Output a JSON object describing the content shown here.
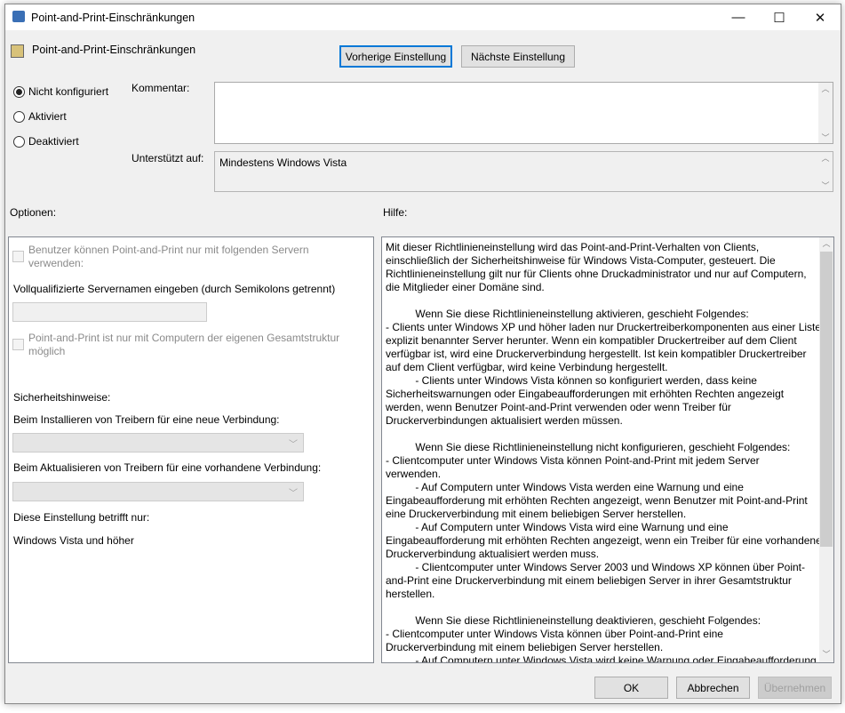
{
  "window": {
    "title": "Point-and-Print-Einschränkungen",
    "minimize": "—",
    "maximize": "☐",
    "close": "✕"
  },
  "header": {
    "policy_name": "Point-and-Print-Einschränkungen",
    "prev_button": "Vorherige Einstellung",
    "next_button": "Nächste Einstellung"
  },
  "state": {
    "options": [
      {
        "label": "Nicht konfiguriert",
        "selected": true
      },
      {
        "label": "Aktiviert",
        "selected": false
      },
      {
        "label": "Deaktiviert",
        "selected": false
      }
    ]
  },
  "comment": {
    "label": "Kommentar:",
    "value": ""
  },
  "supported": {
    "label": "Unterstützt auf:",
    "value": "Mindestens Windows Vista"
  },
  "options_label": "Optionen:",
  "help_label": "Hilfe:",
  "options": {
    "cb_servers": "Benutzer können Point-and-Print nur mit folgenden Servern\nverwenden:",
    "servernames_label": "Vollqualifizierte Servernamen eingeben (durch Semikolons getrennt)",
    "servernames_value": "",
    "cb_forest": "Point-and-Print ist nur mit Computern der eigenen Gesamtstruktur\nmöglich",
    "security_label": "Sicherheitshinweise:",
    "install_label": "Beim Installieren von Treibern für eine neue Verbindung:",
    "update_label": "Beim Aktualisieren von Treibern für eine vorhandene Verbindung:",
    "applies_label": "Diese Einstellung betrifft nur:",
    "applies_value": "Windows Vista und höher"
  },
  "help": {
    "lines": [
      "Mit dieser Richtlinieneinstellung wird das Point-and-Print-Verhalten von Clients,",
      "einschließlich der Sicherheitshinweise für Windows Vista-Computer, gesteuert. Die",
      "Richtlinieneinstellung gilt nur für Clients ohne Druckadministrator und nur auf Computern,",
      "die Mitglieder einer Domäne sind.",
      "",
      "          Wenn Sie diese Richtlinieneinstellung aktivieren, geschieht Folgendes:",
      "- Clients unter Windows XP und höher laden nur Druckertreiberkomponenten aus einer Liste",
      "explizit benannter Server herunter. Wenn ein kompatibler Druckertreiber auf dem Client",
      "verfügbar ist, wird eine Druckerverbindung hergestellt. Ist kein kompatibler Druckertreiber",
      "auf dem Client verfügbar, wird keine Verbindung hergestellt.",
      "          - Clients unter Windows Vista können so konfiguriert werden, dass keine",
      "Sicherheitswarnungen oder Eingabeaufforderungen mit erhöhten Rechten angezeigt",
      "werden, wenn Benutzer Point-and-Print verwenden oder wenn Treiber für",
      "Druckerverbindungen aktualisiert werden müssen.",
      "",
      "          Wenn Sie diese Richtlinieneinstellung nicht konfigurieren, geschieht Folgendes:",
      "- Clientcomputer unter Windows Vista können Point-and-Print mit jedem Server",
      "verwenden.",
      "          - Auf Computern unter Windows Vista werden eine Warnung und eine",
      "Eingabeaufforderung mit erhöhten Rechten angezeigt, wenn Benutzer mit Point-and-Print",
      "eine Druckerverbindung mit einem beliebigen Server herstellen.",
      "          - Auf Computern unter Windows Vista wird eine Warnung und eine",
      "Eingabeaufforderung mit erhöhten Rechten angezeigt, wenn ein Treiber für eine vorhandene",
      "Druckerverbindung aktualisiert werden muss.",
      "          - Clientcomputer unter Windows Server 2003 und Windows XP können über Point-",
      "and-Print eine Druckerverbindung mit einem beliebigen Server in ihrer Gesamtstruktur",
      "herstellen.",
      "",
      "          Wenn Sie diese Richtlinieneinstellung deaktivieren, geschieht Folgendes:",
      "- Clientcomputer unter Windows Vista können über Point-and-Print eine",
      "Druckerverbindung mit einem beliebigen Server herstellen.",
      "          - Auf Computern unter Windows Vista wird keine Warnung oder Eingabeaufforderung"
    ]
  },
  "footer": {
    "ok": "OK",
    "cancel": "Abbrechen",
    "apply": "Übernehmen"
  }
}
